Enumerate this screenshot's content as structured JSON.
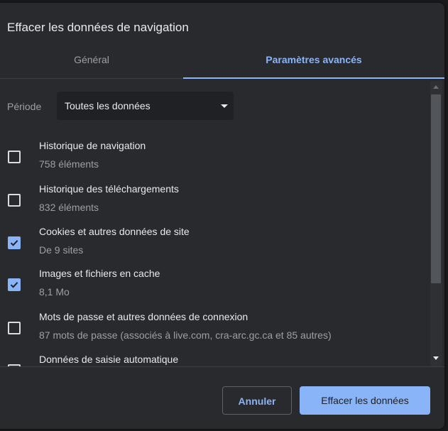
{
  "dialog": {
    "title": "Effacer les données de navigation"
  },
  "tabs": [
    {
      "label": "Général",
      "active": false
    },
    {
      "label": "Paramètres avancés",
      "active": true
    }
  ],
  "period": {
    "label": "Période",
    "value": "Toutes les données"
  },
  "items": [
    {
      "label": "Historique de navigation",
      "detail": "758 éléments",
      "checked": false
    },
    {
      "label": "Historique des téléchargements",
      "detail": "832 éléments",
      "checked": false
    },
    {
      "label": "Cookies et autres données de site",
      "detail": "De 9 sites",
      "checked": true
    },
    {
      "label": "Images et fichiers en cache",
      "detail": "8,1 Mo",
      "checked": true
    },
    {
      "label": "Mots de passe et autres données de connexion",
      "detail": "87 mots de passe (associés à live.com, cra-arc.gc.ca et 85 autres)",
      "checked": false
    },
    {
      "label": "Données de saisie automatique",
      "detail": "",
      "checked": false
    }
  ],
  "buttons": {
    "cancel": "Annuler",
    "clear": "Effacer les données"
  },
  "colors": {
    "accent": "#8ab4f8",
    "background": "#292a2d"
  }
}
